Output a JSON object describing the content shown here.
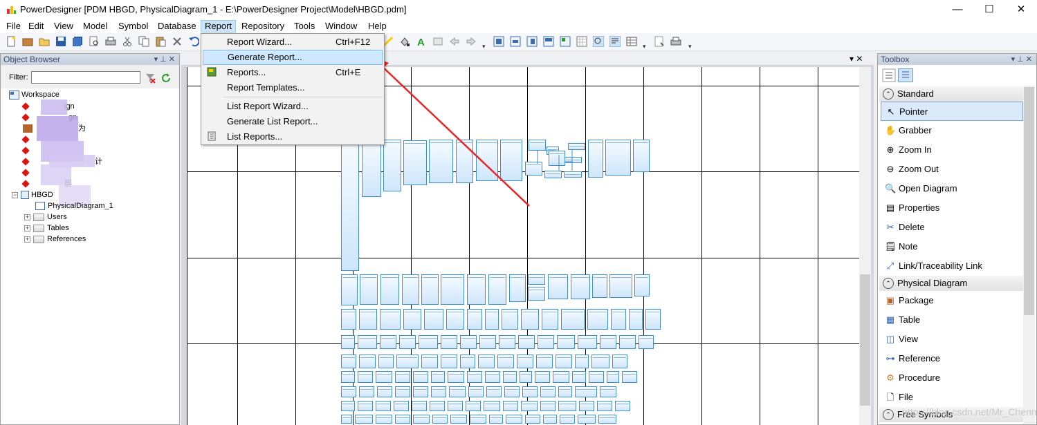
{
  "window": {
    "title": "PowerDesigner [PDM HBGD, PhysicalDiagram_1 - E:\\PowerDesigner Project\\Model\\HBGD.pdm]",
    "minimize": "—",
    "maximize": "☐",
    "close": "✕"
  },
  "menubar": [
    "File",
    "Edit",
    "View",
    "Model",
    "Symbol",
    "Database",
    "Report",
    "Repository",
    "Tools",
    "Window",
    "Help"
  ],
  "report_menu": {
    "items": [
      {
        "label": "Report Wizard...",
        "shortcut": "Ctrl+F12"
      },
      {
        "label": "Generate Report...",
        "shortcut": ""
      },
      {
        "label": "Reports...",
        "shortcut": "Ctrl+E"
      },
      {
        "label": "Report Templates...",
        "shortcut": ""
      },
      {
        "label": "List Report Wizard...",
        "shortcut": ""
      },
      {
        "label": "Generate List Report...",
        "shortcut": ""
      },
      {
        "label": "List Reports...",
        "shortcut": ""
      }
    ]
  },
  "object_browser": {
    "title": "Object Browser",
    "pin": "▾ ⊥ ✕",
    "filter_label": "Filter:",
    "filter_value": "",
    "tree": {
      "workspace": "Workspace",
      "item1": "ign",
      "item2": "gn",
      "item3": "为",
      "item4": "计",
      "item5": "层",
      "hbgd": "HBGD",
      "diagram": "PhysicalDiagram_1",
      "users": "Users",
      "tables": "Tables",
      "references": "References"
    }
  },
  "diagram": {
    "tab_controls": "▾ ✕"
  },
  "toolbox": {
    "title": "Toolbox",
    "pin": "▾ ⊥ ✕",
    "standard_group": "Standard",
    "standard_items": [
      "Pointer",
      "Grabber",
      "Zoom In",
      "Zoom Out",
      "Open Diagram",
      "Properties",
      "Delete",
      "Note",
      "Link/Traceability Link"
    ],
    "physical_group": "Physical Diagram",
    "physical_items": [
      "Package",
      "Table",
      "View",
      "Reference",
      "Procedure",
      "File"
    ],
    "free_group": "Free Symbols"
  },
  "watermark": "https://blog.csdn.net/Mr_Chenn",
  "colors": {
    "accent": "#cde8ff",
    "table_border": "#3f8fc8",
    "arrow": "#ee2424"
  }
}
